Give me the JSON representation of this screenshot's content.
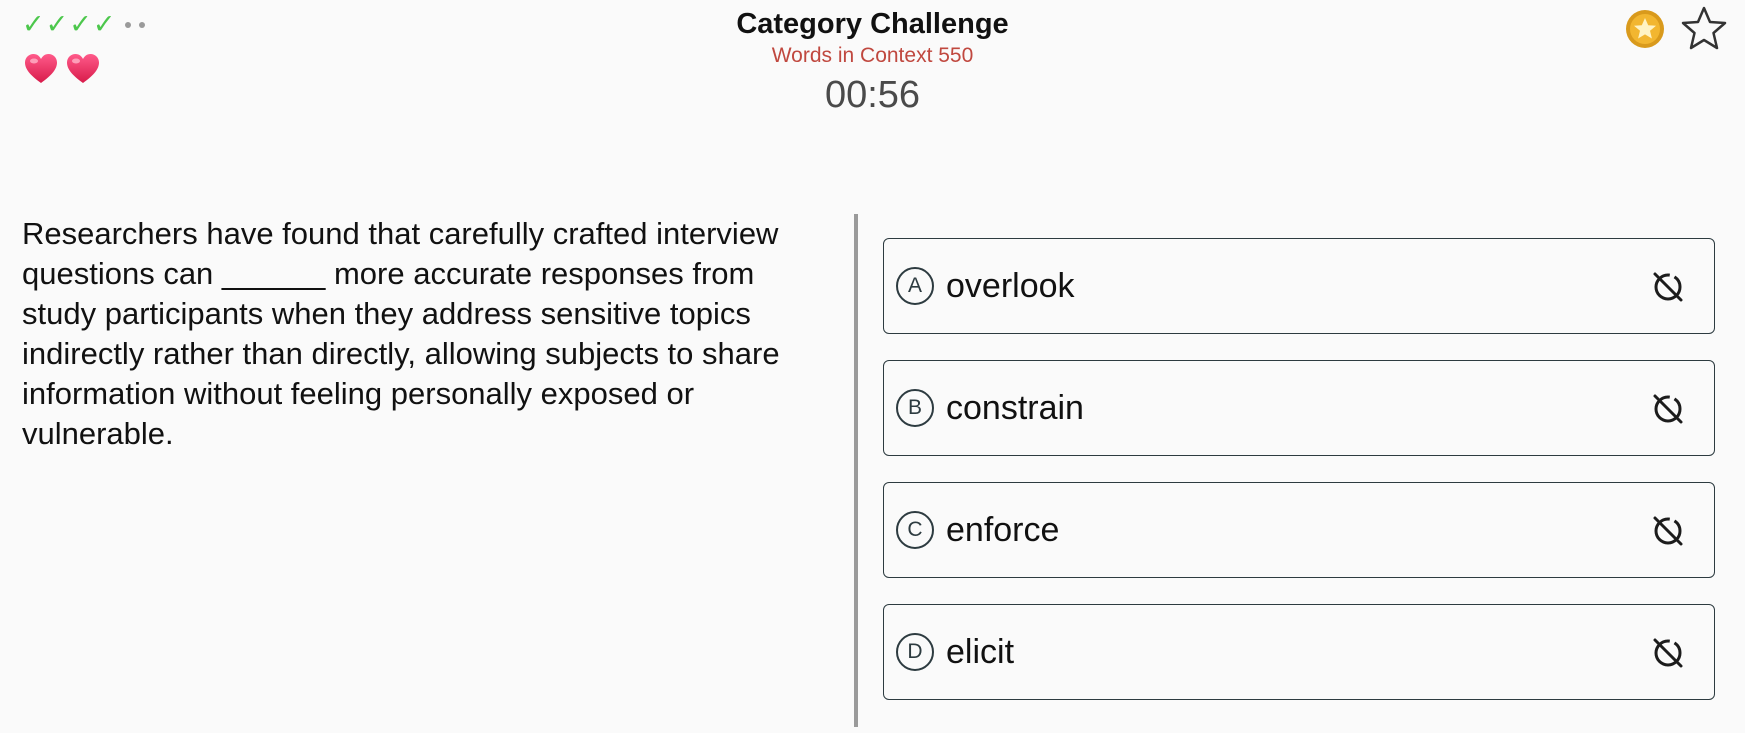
{
  "progress": {
    "checks": [
      "✓",
      "✓",
      "✓",
      "✓"
    ],
    "remaining_dots": 2,
    "check_color": "#4cc74c"
  },
  "lives": {
    "count": 2,
    "icon": "heart-icon"
  },
  "header": {
    "title": "Category Challenge",
    "subtitle": "Words in Context 550",
    "timer": "00:56"
  },
  "question": {
    "text": "Researchers have found that carefully crafted interview questions can ______ more accurate responses from study participants when they address sensitive topics indirectly rather than directly, allowing subjects to share information without feeling personally exposed or vulnerable."
  },
  "options": [
    {
      "letter": "A",
      "text": "overlook"
    },
    {
      "letter": "B",
      "text": "constrain"
    },
    {
      "letter": "C",
      "text": "enforce"
    },
    {
      "letter": "D",
      "text": "elicit"
    }
  ],
  "colors": {
    "accent_red": "#c0483f",
    "border": "#2d3b40",
    "coin": "#e5a823"
  }
}
